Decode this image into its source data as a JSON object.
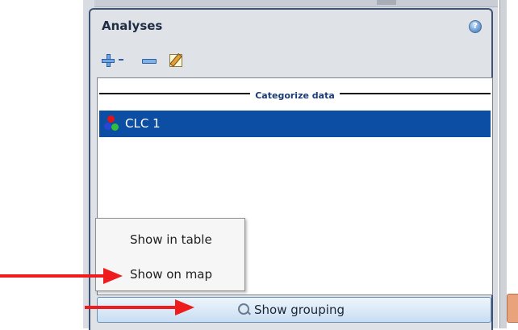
{
  "panel": {
    "title": "Analyses",
    "help_icon": "?"
  },
  "toolbar": {
    "add_icon": "plus-dropdown-icon",
    "remove_icon": "minus-icon",
    "edit_icon": "edit-icon"
  },
  "list": {
    "group_label": "Categorize data",
    "items": [
      {
        "label": "CLC 1",
        "icon": "color-dots-icon",
        "selected": true
      }
    ]
  },
  "context_menu": {
    "items": [
      {
        "label": "Show in table"
      },
      {
        "label": "Show on map"
      }
    ]
  },
  "bottom_button": {
    "label": "Show grouping",
    "icon": "magnifier-icon"
  },
  "colors": {
    "selection": "#0c4ea3",
    "panel_border": "#3f5472",
    "arrow": "#ee1c1c"
  }
}
